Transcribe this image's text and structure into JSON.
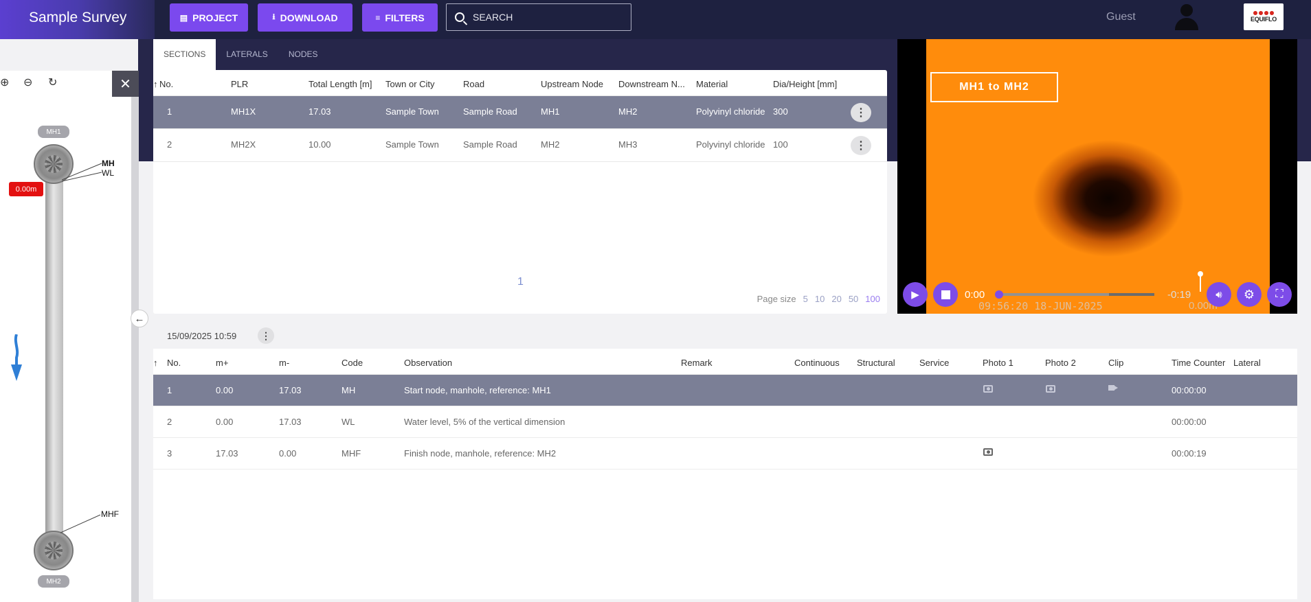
{
  "app": {
    "title": "Sample Survey",
    "user": "Guest",
    "logo_text": "EQUIFLO",
    "accent": "#7b49ee",
    "selection_row": "#7b7f96"
  },
  "toolbar": {
    "project_label": "PROJECT",
    "download_label": "DOWNLOAD",
    "filters_label": "FILTERS",
    "search_placeholder": "SEARCH"
  },
  "drawing": {
    "start_node": "MH1",
    "end_node": "MH2",
    "distance": "0.00m",
    "codes_top": [
      "MH",
      "WL"
    ],
    "code_bottom": "MHF"
  },
  "tabs": [
    "SECTIONS",
    "LATERALS",
    "NODES"
  ],
  "sections": {
    "sort_icon": "↑",
    "columns": [
      "No.",
      "PLR",
      "Total Length [m]",
      "Town or City",
      "Road",
      "Upstream Node",
      "Downstream N...",
      "Material",
      "Dia/Height [mm]"
    ],
    "rows": [
      [
        "1",
        "MH1X",
        "17.03",
        "Sample Town",
        "Sample Road",
        "MH1",
        "MH2",
        "Polyvinyl chloride",
        "300"
      ],
      [
        "2",
        "MH2X",
        "10.00",
        "Sample Town",
        "Sample Road",
        "MH2",
        "MH3",
        "Polyvinyl chloride",
        "100"
      ]
    ],
    "page_number": "1",
    "page_size_label": "Page size",
    "page_sizes": [
      "5",
      "10",
      "20",
      "50",
      "100"
    ],
    "active_page_size": "100"
  },
  "video": {
    "overlay_title": "MH1 to MH2",
    "elapsed": "0:00",
    "remaining": "-0:19",
    "date_overlay": "09:56:20 18-JUN-2025",
    "distance_overlay": "0.00m"
  },
  "observations": {
    "date": "15/09/2025 10:59",
    "columns": [
      "No.",
      "m+",
      "m-",
      "Code",
      "Observation",
      "Remark",
      "Continuous",
      "Structural",
      "Service",
      "Photo 1",
      "Photo 2",
      "Clip",
      "Time Counter",
      "Lateral"
    ],
    "rows": [
      [
        "1",
        "0.00",
        "17.03",
        "MH",
        "Start node, manhole, reference: MH1",
        "",
        "",
        "",
        "",
        "camera-icon",
        "camera-icon",
        "video-icon",
        "00:00:00",
        ""
      ],
      [
        "2",
        "0.00",
        "17.03",
        "WL",
        "Water level, 5% of the vertical dimension",
        "",
        "",
        "",
        "",
        "",
        "",
        "",
        "00:00:00",
        ""
      ],
      [
        "3",
        "17.03",
        "0.00",
        "MHF",
        "Finish node, manhole, reference: MH2",
        "",
        "",
        "",
        "",
        "camera-icon",
        "",
        "",
        "00:00:19",
        ""
      ]
    ]
  }
}
